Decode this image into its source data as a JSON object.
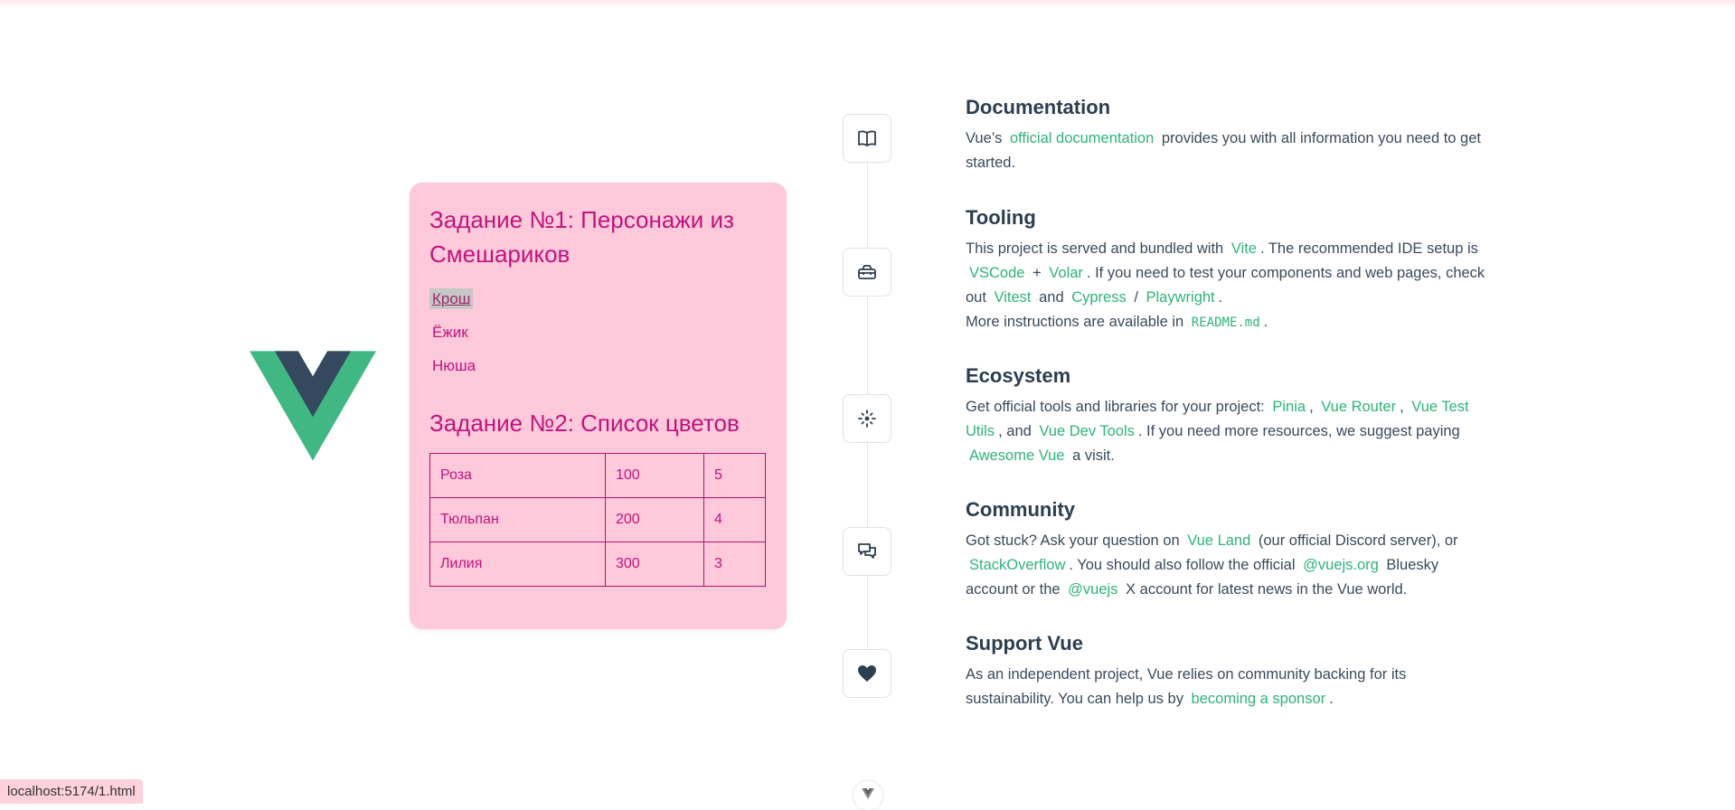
{
  "colors": {
    "accent": "#2fb37a",
    "card_bg": "#ffc9dc",
    "card_text": "#c0147c",
    "heading": "#2c3e50"
  },
  "task1": {
    "title": "Задание №1: Персонажи из Смешариков",
    "characters": [
      "Крош",
      "Ёжик",
      "Нюша"
    ]
  },
  "task2": {
    "title": "Задание №2: Список цветов",
    "rows": [
      [
        "Роза",
        "100",
        "5"
      ],
      [
        "Тюльпан",
        "200",
        "4"
      ],
      [
        "Лилия",
        "300",
        "3"
      ]
    ]
  },
  "docs": {
    "title": "Documentation",
    "t1": "Vue’s",
    "l1": "official documentation",
    "t2": "provides you with all information you need to get started."
  },
  "tooling": {
    "title": "Tooling",
    "t1": "This project is served and bundled with",
    "vite": "Vite",
    "t2": ". The recommended IDE setup is",
    "vscode": "VSCode",
    "plus": "+",
    "volar": "Volar",
    "t3": ". If you need to test your components and web pages, check out",
    "vitest": "Vitest",
    "and": "and",
    "cypress": "Cypress",
    "slash": "/",
    "playwright": "Playwright",
    "dot": ".",
    "t4": "More instructions are available in",
    "readme": "README.md",
    "dot2": "."
  },
  "ecosystem": {
    "title": "Ecosystem",
    "t1": "Get official tools and libraries for your project:",
    "pinia": "Pinia",
    "c1": ",",
    "router": "Vue Router",
    "c2": ",",
    "testutils": "Vue Test Utils",
    "t2": ", and",
    "devtools": "Vue Dev Tools",
    "t3": ". If you need more resources, we suggest paying",
    "awesome": "Awesome Vue",
    "t4": "a visit."
  },
  "community": {
    "title": "Community",
    "t1": "Got stuck? Ask your question on",
    "vueland": "Vue Land",
    "t2": "(our official Discord server), or",
    "so": "StackOverflow",
    "t3": ". You should also follow the official",
    "bsky": "@vuejs.org",
    "t4": "Bluesky account or the",
    "x": "@vuejs",
    "t5": "X account for latest news in the Vue world."
  },
  "support": {
    "title": "Support Vue",
    "t1": "As an independent project, Vue relies on community backing for its sustainability. You can help us by",
    "sponsor": "becoming a sponsor",
    "dot": "."
  },
  "status_url": "localhost:5174/1.html",
  "icons": [
    "book-icon",
    "toolbox-icon",
    "ecosystem-icon",
    "chat-icon",
    "heart-icon",
    "vue-logo"
  ]
}
